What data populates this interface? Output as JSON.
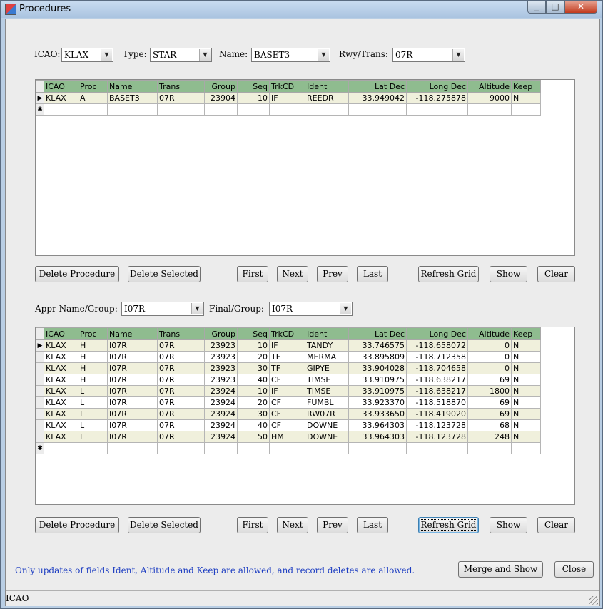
{
  "window": {
    "title": "Procedures"
  },
  "filters": {
    "icao_label": "ICAO:",
    "icao_value": "KLAX",
    "type_label": "Type:",
    "type_value": "STAR",
    "name_label": "Name:",
    "name_value": "BASET3",
    "rwy_label": "Rwy/Trans:",
    "rwy_value": "07R"
  },
  "appr": {
    "name_label": "Appr Name/Group:",
    "name_value": "I07R",
    "final_label": "Final/Group:",
    "final_value": "I07R"
  },
  "columns": [
    "ICAO",
    "Proc",
    "Name",
    "Trans",
    "Group",
    "Seq",
    "TrkCD",
    "Ident",
    "Lat Dec",
    "Long Dec",
    "Altitude",
    "Keep"
  ],
  "grid1": {
    "rows": [
      [
        "KLAX",
        "A",
        "BASET3",
        "07R",
        "23904",
        "10",
        "IF",
        "REEDR",
        "33.949042",
        "-118.275878",
        "9000",
        "N"
      ]
    ]
  },
  "grid2": {
    "rows": [
      [
        "KLAX",
        "H",
        "I07R",
        "07R",
        "23923",
        "10",
        "IF",
        "TANDY",
        "33.746575",
        "-118.658072",
        "0",
        "N"
      ],
      [
        "KLAX",
        "H",
        "I07R",
        "07R",
        "23923",
        "20",
        "TF",
        "MERMA",
        "33.895809",
        "-118.712358",
        "0",
        "N"
      ],
      [
        "KLAX",
        "H",
        "I07R",
        "07R",
        "23923",
        "30",
        "TF",
        "GIPYE",
        "33.904028",
        "-118.704658",
        "0",
        "N"
      ],
      [
        "KLAX",
        "H",
        "I07R",
        "07R",
        "23923",
        "40",
        "CF",
        "TIMSE",
        "33.910975",
        "-118.638217",
        "69",
        "N"
      ],
      [
        "KLAX",
        "L",
        "I07R",
        "07R",
        "23924",
        "10",
        "IF",
        "TIMSE",
        "33.910975",
        "-118.638217",
        "1800",
        "N"
      ],
      [
        "KLAX",
        "L",
        "I07R",
        "07R",
        "23924",
        "20",
        "CF",
        "FUMBL",
        "33.923370",
        "-118.518870",
        "69",
        "N"
      ],
      [
        "KLAX",
        "L",
        "I07R",
        "07R",
        "23924",
        "30",
        "CF",
        "RW07R",
        "33.933650",
        "-118.419020",
        "69",
        "N"
      ],
      [
        "KLAX",
        "L",
        "I07R",
        "07R",
        "23924",
        "40",
        "CF",
        "DOWNE",
        "33.964303",
        "-118.123728",
        "68",
        "N"
      ],
      [
        "KLAX",
        "L",
        "I07R",
        "07R",
        "23924",
        "50",
        "HM",
        "DOWNE",
        "33.964303",
        "-118.123728",
        "248",
        "N"
      ]
    ]
  },
  "buttons": {
    "delete_procedure": "Delete Procedure",
    "delete_selected": "Delete Selected",
    "first": "First",
    "next": "Next",
    "prev": "Prev",
    "last": "Last",
    "refresh_grid": "Refresh Grid",
    "show": "Show",
    "clear": "Clear",
    "merge_and_show": "Merge and Show",
    "close": "Close"
  },
  "notice": "Only updates of fields Ident, Altitude and Keep are allowed, and record deletes are allowed.",
  "status": "ICAO",
  "icons": {
    "current_row": "triangle-right",
    "new_row": "asterisk"
  },
  "colors": {
    "header_bg": "#8fbc8f",
    "alt_row": "#f0f0dc",
    "notice_text": "#1f3fc2"
  }
}
